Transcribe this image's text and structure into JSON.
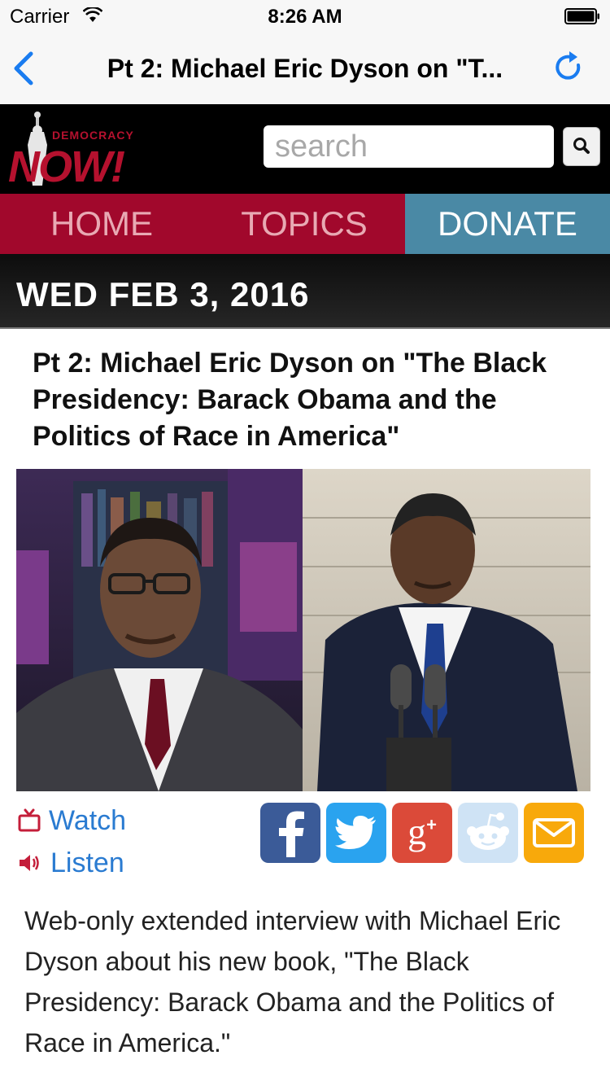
{
  "status_bar": {
    "carrier": "Carrier",
    "time": "8:26 AM"
  },
  "nav": {
    "title": "Pt 2: Michael Eric Dyson on \"T..."
  },
  "header": {
    "logo_small": "DEMOCRACY",
    "logo_big": "NOW!",
    "search_placeholder": "search"
  },
  "menu": {
    "home": "HOME",
    "topics": "TOPICS",
    "donate": "DONATE"
  },
  "date": "WED FEB 3, 2016",
  "article": {
    "headline": "Pt 2: Michael Eric Dyson on \"The Black Presidency: Barack Obama and the Politics of Race in America\"",
    "watch_label": "Watch",
    "listen_label": "Listen",
    "description": "Web-only extended interview with Michael Eric Dyson about his new book, \"The Black Presidency: Barack Obama and the Politics of Race in America.\""
  },
  "share": [
    "facebook",
    "twitter",
    "google-plus",
    "reddit",
    "email"
  ],
  "colors": {
    "menu_red": "#a1082c",
    "donate_blue": "#4a89a5",
    "link_blue": "#2a7bd1",
    "ios_blue": "#1a7cf0",
    "logo_red": "#b5112e"
  }
}
